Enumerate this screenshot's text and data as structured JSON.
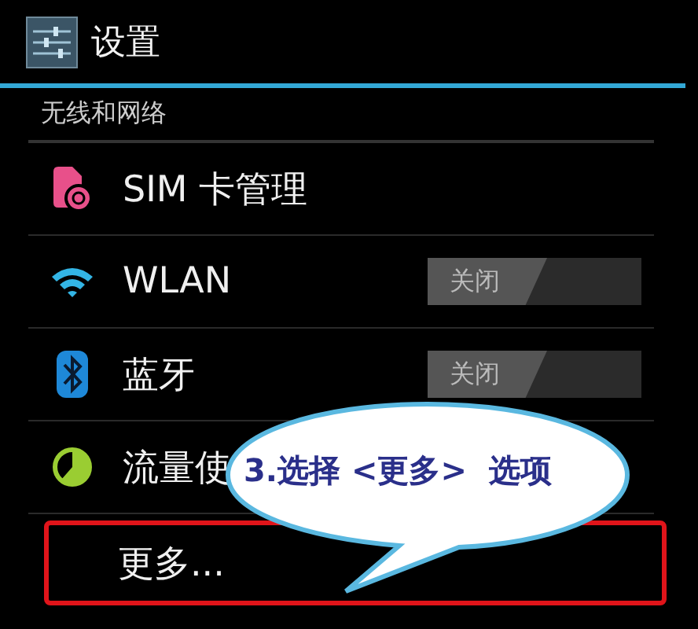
{
  "header": {
    "title": "设置"
  },
  "section": {
    "title": "无线和网络"
  },
  "items": [
    {
      "kind": "sim",
      "label": "SIM 卡管理"
    },
    {
      "kind": "wifi",
      "label": "WLAN",
      "toggle": {
        "on": false,
        "label": "关闭"
      }
    },
    {
      "kind": "bluetooth",
      "label": "蓝牙",
      "toggle": {
        "on": false,
        "label": "关闭"
      }
    },
    {
      "kind": "data",
      "label": "流量使"
    },
    {
      "kind": "none",
      "label": "更多...",
      "highlighted": true
    }
  ],
  "callout": {
    "text": "3.选择 <更多>  选项"
  }
}
